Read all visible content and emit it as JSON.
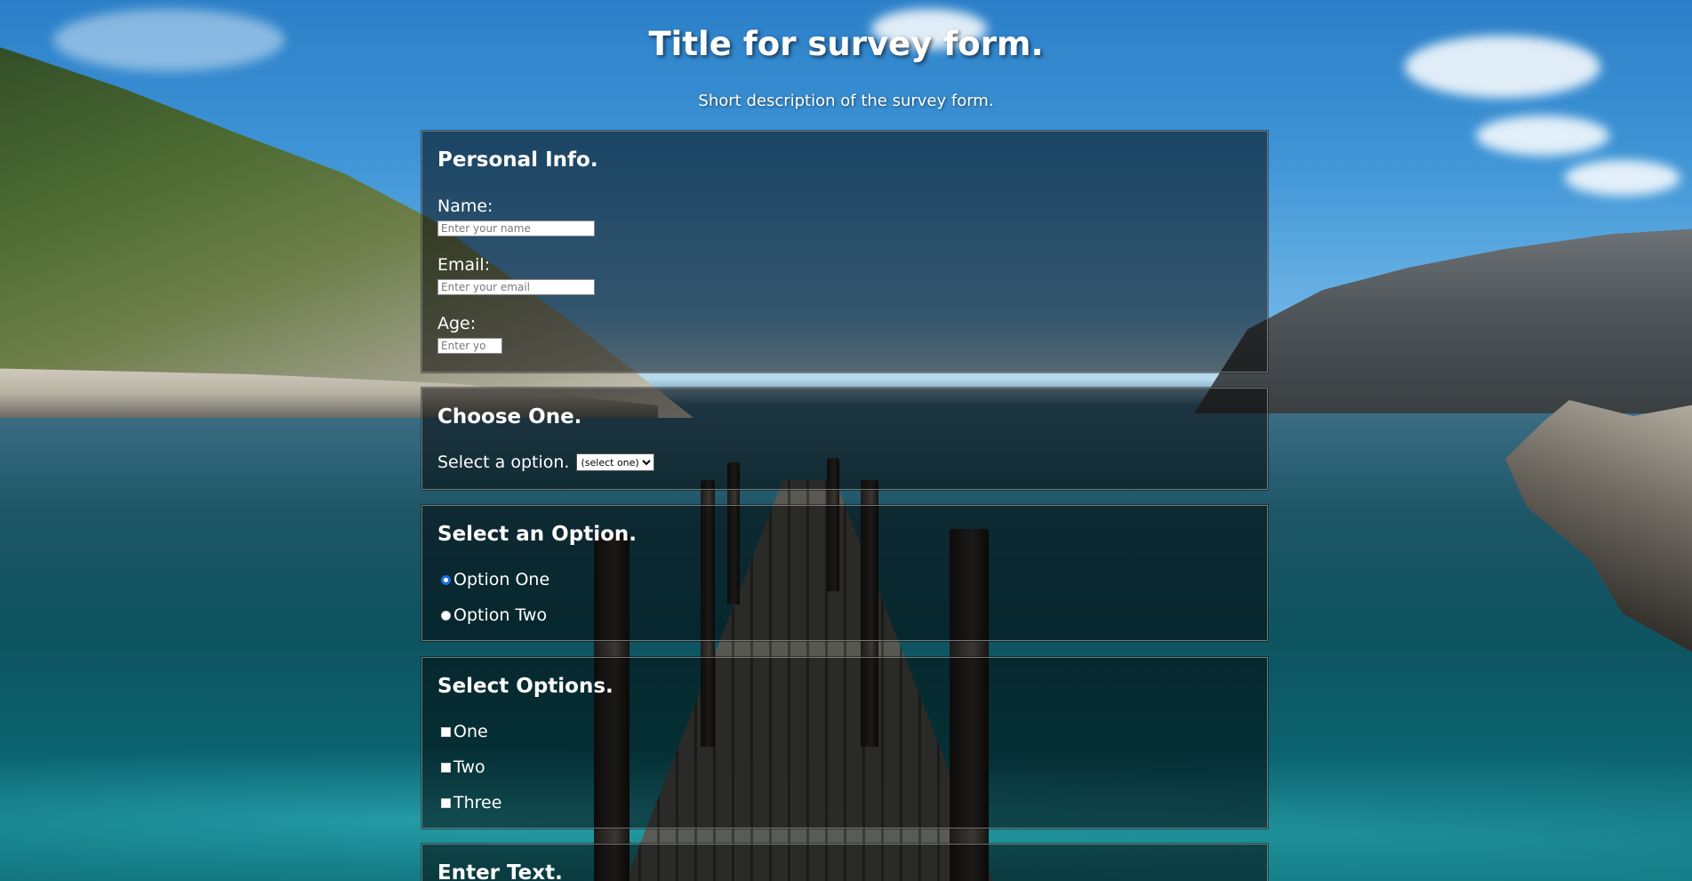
{
  "header": {
    "title": "Title for survey form.",
    "description": "Short description of the survey form."
  },
  "personal_info": {
    "heading": "Personal Info.",
    "name_label": "Name:",
    "name_placeholder": "Enter your name",
    "email_label": "Email:",
    "email_placeholder": "Enter your email",
    "age_label": "Age:",
    "age_placeholder": "Enter yo"
  },
  "choose_one": {
    "heading": "Choose One.",
    "select_label": "Select a option.",
    "selected_value": "(select one)"
  },
  "select_option": {
    "heading": "Select an Option.",
    "options": [
      {
        "label": "Option One",
        "checked": true
      },
      {
        "label": "Option Two",
        "checked": false
      }
    ]
  },
  "select_options": {
    "heading": "Select Options.",
    "options": [
      {
        "label": "One",
        "checked": false
      },
      {
        "label": "Two",
        "checked": false
      },
      {
        "label": "Three",
        "checked": false
      }
    ]
  },
  "enter_text": {
    "heading": "Enter Text."
  },
  "colors": {
    "radio_accent": "#1e6fe0",
    "section_background": "rgba(0,0,0,0.52)"
  }
}
